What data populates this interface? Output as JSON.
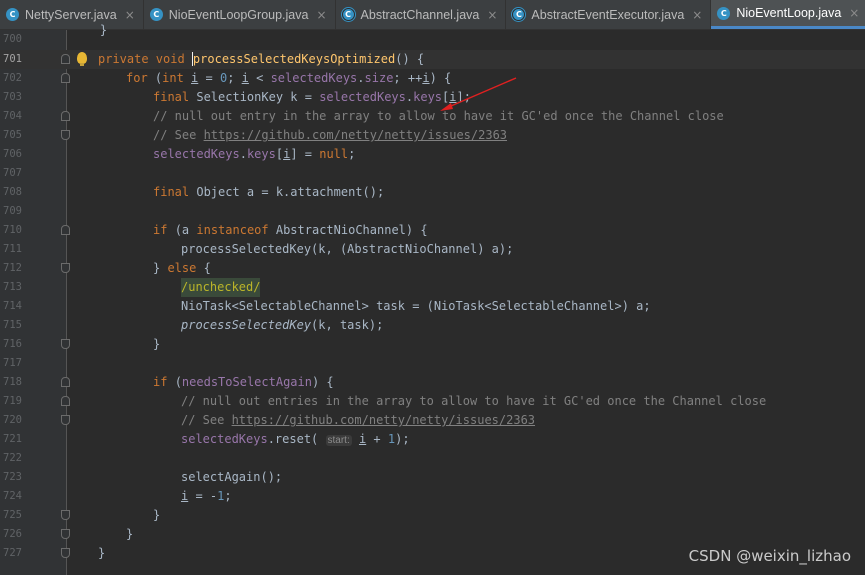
{
  "tabs": [
    {
      "label": "NettyServer.java",
      "icon": "class-runnable-icon",
      "active": false
    },
    {
      "label": "NioEventLoopGroup.java",
      "icon": "class-icon",
      "active": false
    },
    {
      "label": "AbstractChannel.java",
      "icon": "abstract-class-icon",
      "active": false
    },
    {
      "label": "AbstractEventExecutor.java",
      "icon": "abstract-class-icon",
      "active": false
    },
    {
      "label": "NioEventLoop.java",
      "icon": "class-icon",
      "active": true
    }
  ],
  "close_glyph": "×",
  "line_numbers": [
    "700",
    "701",
    "702",
    "703",
    "704",
    "705",
    "706",
    "707",
    "708",
    "709",
    "710",
    "711",
    "712",
    "713",
    "714",
    "715",
    "716",
    "717",
    "718",
    "719",
    "720",
    "721",
    "722",
    "723",
    "724",
    "725",
    "726",
    "727"
  ],
  "code": {
    "l700": {
      "text": "    }"
    },
    "l701": {
      "kw": "private void ",
      "method": "processSelectedKeysOptimized",
      "rest": "() {"
    },
    "l702": {
      "kw": "for ",
      "p1": "(",
      "kw2": "int ",
      "var": "i",
      "p2": " = ",
      "n0": "0",
      "p3": "; ",
      "var2": "i",
      "p4": " < ",
      "field": "selectedKeys",
      "p5": ".",
      "field2": "size",
      "p6": "; ++",
      "var3": "i",
      "p7": ") {"
    },
    "l703": {
      "kw": "final ",
      "p1": "SelectionKey k = ",
      "field": "selectedKeys",
      "p2": ".",
      "field2": "keys",
      "p3": "[",
      "var": "i",
      "p4": "];"
    },
    "l704": {
      "comment": "// null out entry in the array to allow to have it GC'ed once the Channel close"
    },
    "l705": {
      "comment": "// See ",
      "link": "https://github.com/netty/netty/issues/2363"
    },
    "l706": {
      "field": "selectedKeys",
      "p1": ".",
      "field2": "keys",
      "p2": "[",
      "var": "i",
      "p3": "] = ",
      "kw": "null",
      "p4": ";"
    },
    "l708": {
      "kw": "final ",
      "p1": "Object a = k.attachment();"
    },
    "l710": {
      "kw": "if ",
      "p1": "(a ",
      "kw2": "instanceof ",
      "p2": "AbstractNioChannel) {"
    },
    "l711": {
      "p1": "processSelectedKey(k, (AbstractNioChannel) a);"
    },
    "l712": {
      "p1": "} ",
      "kw": "else ",
      "p2": "{"
    },
    "l713": {
      "annotation": "/unchecked/"
    },
    "l714": {
      "p1": "NioTask<SelectableChannel> task = (NioTask<SelectableChannel>) a;"
    },
    "l715": {
      "method": "processSelectedKey",
      "p1": "(k, task);"
    },
    "l716": {
      "p1": "}"
    },
    "l718": {
      "kw": "if ",
      "p1": "(",
      "field": "needsToSelectAgain",
      "p2": ") {"
    },
    "l719": {
      "comment": "// null out entries in the array to allow to have it GC'ed once the Channel close"
    },
    "l720": {
      "comment": "// See ",
      "link": "https://github.com/netty/netty/issues/2363"
    },
    "l721": {
      "field": "selectedKeys",
      "p1": ".reset( ",
      "hint": "start:",
      "var": "i",
      "p2": " + ",
      "n1": "1",
      "p3": ");"
    },
    "l723": {
      "p1": "selectAgain();"
    },
    "l724": {
      "var": "i",
      "p1": " = -",
      "n1": "1",
      "p2": ";"
    },
    "l725": {
      "p1": "}"
    },
    "l726": {
      "p1": "}"
    },
    "l727": {
      "p1": "}"
    }
  },
  "watermark": "CSDN @weixin_lizhao",
  "colors": {
    "background": "#2b2b2b",
    "keyword": "#cc7832",
    "method": "#ffc66d",
    "field": "#9876aa",
    "number": "#6897bb",
    "comment": "#808080",
    "arrow": "#e02020"
  }
}
